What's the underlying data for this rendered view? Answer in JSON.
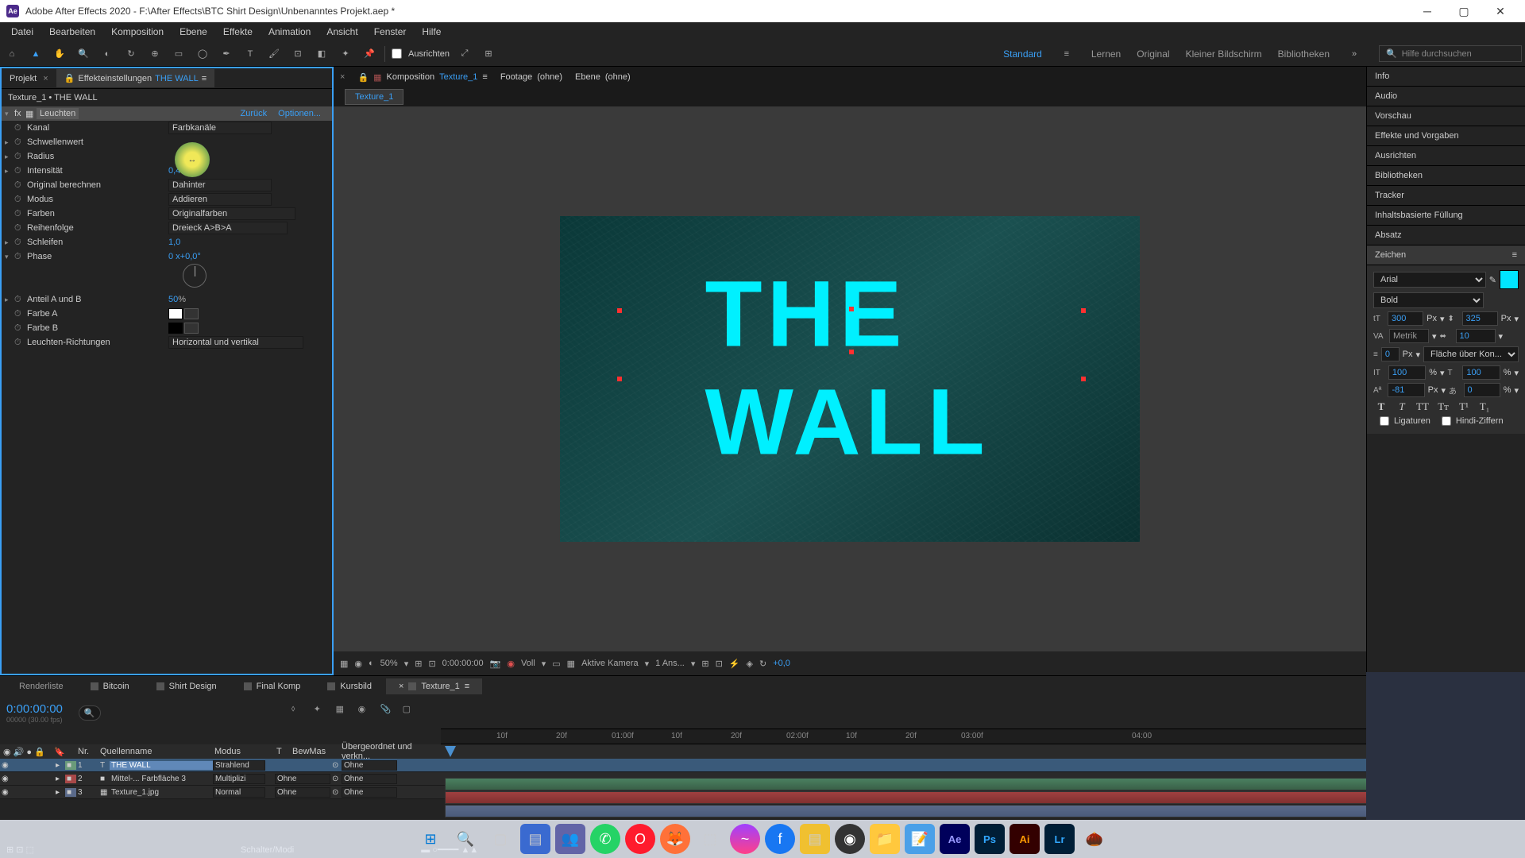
{
  "window": {
    "app_icon": "Ae",
    "title": "Adobe After Effects 2020 - F:\\After Effects\\BTC Shirt Design\\Unbenanntes Projekt.aep *"
  },
  "menu": [
    "Datei",
    "Bearbeiten",
    "Komposition",
    "Ebene",
    "Effekte",
    "Animation",
    "Ansicht",
    "Fenster",
    "Hilfe"
  ],
  "toolbar": {
    "ausrichten": "Ausrichten",
    "workspace_active": "Standard",
    "workspaces": [
      "Lernen",
      "Original",
      "Kleiner Bildschirm",
      "Bibliotheken"
    ],
    "search_placeholder": "Hilfe durchsuchen"
  },
  "left": {
    "tab_project": "Projekt",
    "tab_fx": "Effekteinstellungen",
    "tab_fx_target": "THE WALL",
    "breadcrumb": "Texture_1 • THE WALL",
    "fx_name": "Leuchten",
    "link_back": "Zurück",
    "link_options": "Optionen...",
    "props": {
      "kanal": {
        "label": "Kanal",
        "value": "Farbkanäle"
      },
      "schwellenwert": {
        "label": "Schwellenwert"
      },
      "radius": {
        "label": "Radius"
      },
      "intensitaet": {
        "label": "Intensität",
        "value": "0,4"
      },
      "original": {
        "label": "Original berechnen",
        "value": "Dahinter"
      },
      "modus": {
        "label": "Modus",
        "value": "Addieren"
      },
      "farben": {
        "label": "Farben",
        "value": "Originalfarben"
      },
      "reihenfolge": {
        "label": "Reihenfolge",
        "value": "Dreieck A>B>A"
      },
      "schleifen": {
        "label": "Schleifen",
        "value": "1,0"
      },
      "phase": {
        "label": "Phase",
        "value": "0 x+0,0°"
      },
      "anteil": {
        "label": "Anteil A und B",
        "value": "50",
        "unit": "%"
      },
      "farbe_a": {
        "label": "Farbe A"
      },
      "farbe_b": {
        "label": "Farbe B"
      },
      "richtungen": {
        "label": "Leuchten-Richtungen",
        "value": "Horizontal und vertikal"
      }
    }
  },
  "center": {
    "tab_comp": "Komposition",
    "tab_comp_name": "Texture_1",
    "tab_footage": "Footage",
    "tab_footage_val": "(ohne)",
    "tab_ebene": "Ebene",
    "tab_ebene_val": "(ohne)",
    "subtab": "Texture_1",
    "text": "THE WALL",
    "controls": {
      "zoom": "50%",
      "time": "0:00:00:00",
      "res": "Voll",
      "camera": "Aktive Kamera",
      "views": "1 Ans...",
      "exposure": "+0,0"
    }
  },
  "right": {
    "sections": [
      "Info",
      "Audio",
      "Vorschau",
      "Effekte und Vorgaben",
      "Ausrichten",
      "Bibliotheken",
      "Tracker",
      "Inhaltsbasierte Füllung",
      "Absatz"
    ],
    "char_title": "Zeichen",
    "font": "Arial",
    "weight": "Bold",
    "size": "300",
    "size_unit": "Px",
    "leading": "325",
    "leading_unit": "Px",
    "kerning": "Metrik",
    "tracking": "10",
    "stroke": "0",
    "stroke_unit": "Px",
    "stroke_mode": "Fläche über Kon...",
    "hscale": "100",
    "hscale_unit": "%",
    "vscale": "100",
    "vscale_unit": "%",
    "baseline": "-81",
    "baseline_unit": "Px",
    "tsume": "0",
    "tsume_unit": "%",
    "ligaturen": "Ligaturen",
    "hindi": "Hindi-Ziffern"
  },
  "timeline": {
    "tabs": [
      "Renderliste",
      "Bitcoin",
      "Shirt Design",
      "Final Komp",
      "Kursbild",
      "Texture_1"
    ],
    "active_tab": 5,
    "timecode": "0:00:00:00",
    "timecode_sub": "00000 (30.00 fps)",
    "headers": {
      "nr": "Nr.",
      "quelle": "Quellenname",
      "modus": "Modus",
      "t": "T",
      "bewmas": "BewMas",
      "ueber": "Übergeordnet und verkn..."
    },
    "ruler": [
      "10f",
      "20f",
      "01:00f",
      "10f",
      "20f",
      "02:00f",
      "10f",
      "20f",
      "03:00f",
      "04:00"
    ],
    "layers": [
      {
        "nr": "1",
        "name": "THE WALL",
        "modus": "Strahlend",
        "bewmas": "",
        "parent": "Ohne",
        "color": "#6a9a7a",
        "type": "T"
      },
      {
        "nr": "2",
        "name": "Mittel-... Farbfläche 3",
        "modus": "Multiplizi",
        "bewmas": "Ohne",
        "parent": "Ohne",
        "color": "#a84848",
        "type": "■"
      },
      {
        "nr": "3",
        "name": "Texture_1.jpg",
        "modus": "Normal",
        "bewmas": "Ohne",
        "parent": "Ohne",
        "color": "#5a6a8a",
        "type": "▦"
      }
    ],
    "footer": "Schalter/Modi"
  }
}
